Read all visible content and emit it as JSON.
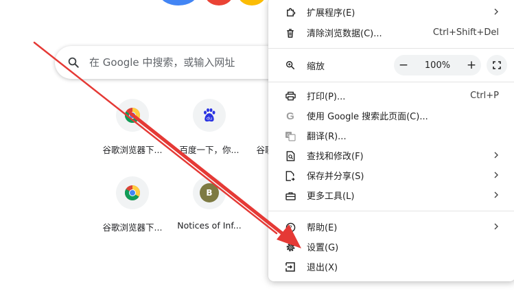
{
  "search": {
    "placeholder": "在 Google 中搜索，或输入网址"
  },
  "shortcuts": [
    {
      "label": "谷歌浏览器下...",
      "icon": "chrome-icon"
    },
    {
      "label": "百度一下，你...",
      "icon": "baidu-icon"
    },
    {
      "label": "谷歌",
      "icon": "chrome-icon"
    },
    {
      "label": "谷歌浏览器下...",
      "icon": "chrome-icon"
    },
    {
      "label": "Notices of Inf...",
      "icon": "letter-avatar",
      "letter": "B"
    }
  ],
  "menu": {
    "extensions": "扩展程序(E)",
    "clear_data": "清除浏览数据(C)...",
    "clear_data_shortcut": "Ctrl+Shift+Del",
    "zoom": "缩放",
    "zoom_minus": "−",
    "zoom_value": "100%",
    "zoom_plus": "+",
    "print": "打印(P)...",
    "print_shortcut": "Ctrl+P",
    "search_google": "使用 Google 搜索此页面(C)...",
    "translate": "翻译(R)...",
    "find_edit": "查找和修改(F)",
    "save_share": "保存并分享(S)",
    "more_tools": "更多工具(L)",
    "help": "帮助(E)",
    "settings": "设置(G)",
    "exit": "退出(X)"
  },
  "colors": {
    "annotation_arrow": "#e53935",
    "avatar_b": "#7d7a42"
  }
}
